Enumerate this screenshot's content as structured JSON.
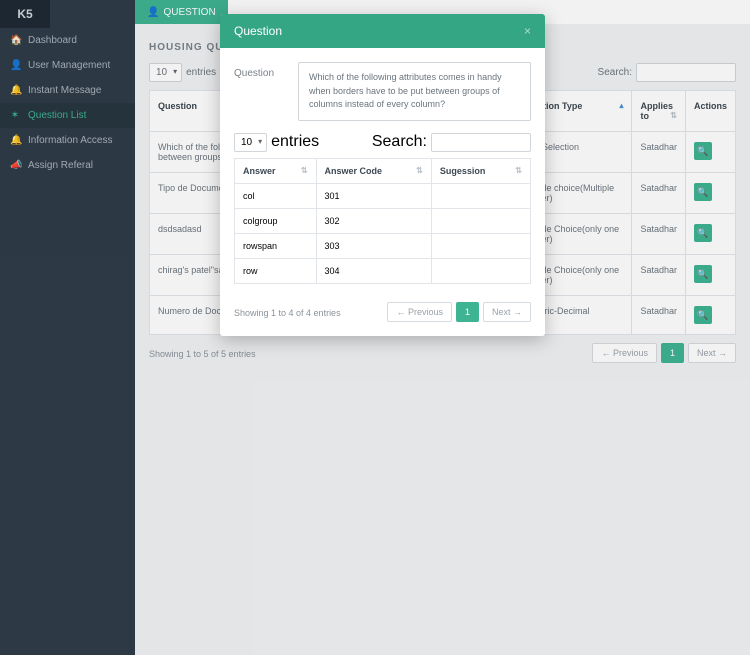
{
  "sidebar": {
    "logo": "K5",
    "items": [
      {
        "icon": "🏠",
        "label": "Dashboard"
      },
      {
        "icon": "👤",
        "label": "User Management"
      },
      {
        "icon": "🔔",
        "label": "Instant Message"
      },
      {
        "icon": "✶",
        "label": "Question List"
      },
      {
        "icon": "🔔",
        "label": "Information Access"
      },
      {
        "icon": "📣",
        "label": "Assign Referal"
      }
    ]
  },
  "tab": {
    "icon": "👤",
    "label": "QUESTION"
  },
  "page": {
    "title": "HOUSING QUESTIONS",
    "entries_select": "10",
    "entries_label": "entries",
    "search_label": "Search:",
    "headers": {
      "question": "Question",
      "qtype": "Question Type",
      "applies": "Applies to",
      "actions": "Actions"
    },
    "rows": [
      {
        "q": "Which of the following attributes comes in handy when borders have to be put between groups of columns instead of every column?",
        "t": "Date Selection",
        "a": "Satadhar"
      },
      {
        "q": "Tipo de Documento",
        "t": "Multiple choice(Multiple answer)",
        "a": "Satadhar"
      },
      {
        "q": "dsdsadasd",
        "t": "Multiple Choice(only one answer)",
        "a": "Satadhar"
      },
      {
        "q": "chirag's patel\"sameer#kotadiya",
        "t": "Multiple Choice(only one answer)",
        "a": "Satadhar"
      },
      {
        "q": "Numero de Documento",
        "t": "Numeric-Decimal",
        "a": "Satadhar"
      }
    ],
    "footer": "Showing 1 to 5 of 5 entries",
    "prev": "← Previous",
    "page1": "1",
    "next": "Next →"
  },
  "modal": {
    "title": "Question",
    "close": "×",
    "q_label": "Question",
    "q_text": "Which of the following attributes comes in handy when borders have to be put between groups of columns instead of every column?",
    "entries_select": "10",
    "entries_label": "entries",
    "search_label": "Search:",
    "headers": {
      "answer": "Answer",
      "code": "Answer Code",
      "sug": "Sugession"
    },
    "rows": [
      {
        "a": "col",
        "c": "301",
        "s": ""
      },
      {
        "a": "colgroup",
        "c": "302",
        "s": ""
      },
      {
        "a": "rowspan",
        "c": "303",
        "s": ""
      },
      {
        "a": "row",
        "c": "304",
        "s": ""
      }
    ],
    "footer": "Showing 1 to 4 of 4 entries",
    "prev": "← Previous",
    "page1": "1",
    "next": "Next →"
  }
}
